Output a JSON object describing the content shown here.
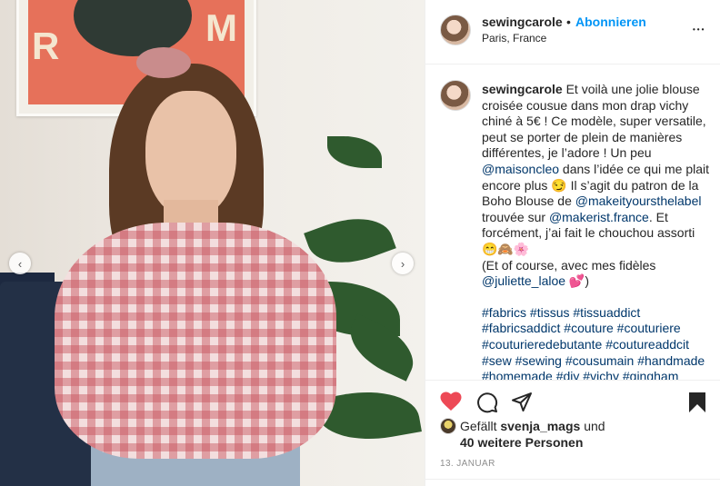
{
  "post": {
    "carousel_prev": "‹",
    "carousel_next": "›"
  },
  "header": {
    "username": "sewingcarole",
    "separator": "•",
    "follow_label": "Abonnieren",
    "location": "Paris, France",
    "more_icon": "more-horizontal-icon",
    "more_symbol": "•••"
  },
  "caption": {
    "username": "sewingcarole",
    "text_1": " Et voilà une jolie blouse croisée cousue dans mon drap vichy chiné à 5€ ! Ce modèle, super versatile, peut se porter de plein de manières différentes, je l’adore ! Un peu ",
    "mention_1": "@maisoncleo",
    "text_2": " dans l’idée ce qui me plait encore plus 😏 Il s’agit du patron de la Boho Blouse de ",
    "mention_2": "@makeityoursthelabel",
    "text_3": " trouvée sur ",
    "mention_3": "@makerist.france",
    "text_4": ". Et forcément, j’ai fait le chouchou assorti 😁🙈🌸",
    "text_5": "(Et of course, avec mes fidèles ",
    "mention_4": "@juliette_laloe",
    "text_6": " 💕)",
    "hashtags": [
      "#fabrics",
      "#tissus",
      "#tissuaddict",
      "#fabricsaddict",
      "#couture",
      "#couturiere",
      "#couturieredebutante",
      "#coutureaddcit",
      "#sew",
      "#sewing",
      "#cousumain",
      "#handmade",
      "#homemade",
      "#diy",
      "#vichy",
      "#gingham"
    ]
  },
  "actions": {
    "like_icon": "heart-filled-icon",
    "comment_icon": "comment-icon",
    "share_icon": "paper-plane-icon",
    "save_icon": "bookmark-filled-icon",
    "like_color": "#ed4956"
  },
  "likes": {
    "prefix": "Gefällt ",
    "user": "svenja_mags",
    "conjunction": " und",
    "others": "40 weitere Personen"
  },
  "date": "13. JANUAR"
}
